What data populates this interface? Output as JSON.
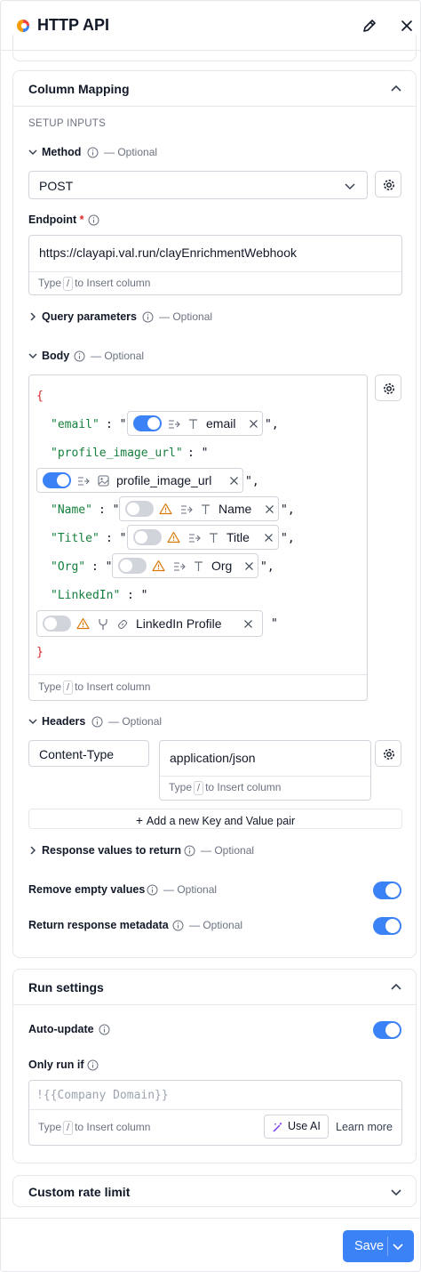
{
  "header": {
    "title": "HTTP API"
  },
  "column_mapping": {
    "title": "Column Mapping",
    "setup_inputs": "SETUP INPUTS",
    "method": {
      "label": "Method",
      "optional": "— Optional",
      "value": "POST"
    },
    "endpoint": {
      "label": "Endpoint",
      "required": "*",
      "value": "https://clayapi.val.run/clayEnrichmentWebhook",
      "hint_pre": "Type",
      "hint_key": "/",
      "hint_post": "to Insert column"
    },
    "query": {
      "label": "Query parameters",
      "optional": "— Optional"
    },
    "body": {
      "label": "Body",
      "optional": "— Optional",
      "open_brace": "{",
      "close_brace": "}",
      "keys": {
        "email": "\"email\"",
        "profile_image_url": "\"profile_image_url\"",
        "name": "\"Name\"",
        "title": "\"Title\"",
        "org": "\"Org\"",
        "linkedin": "\"LinkedIn\""
      },
      "colon_q": ": \"",
      "end_q": "\",",
      "end_q_last": "\"",
      "chips": {
        "email": "email",
        "profile_image_url": "profile_image_url",
        "name": "Name",
        "title": "Title",
        "org": "Org",
        "linkedin": "LinkedIn Profile"
      },
      "hint_pre": "Type",
      "hint_key": "/",
      "hint_post": "to Insert column"
    },
    "headers": {
      "label": "Headers",
      "optional": "— Optional",
      "key": "Content-Type",
      "value": "application/json",
      "hint_pre": "Type",
      "hint_key": "/",
      "hint_post": "to Insert column",
      "add_label": "Add a new Key and Value pair"
    },
    "response": {
      "label": "Response values to return",
      "optional": "— Optional"
    },
    "remove_empty": {
      "label": "Remove empty values",
      "optional": "— Optional",
      "on": true
    },
    "return_meta": {
      "label": "Return response metadata",
      "optional": "— Optional",
      "on": true
    }
  },
  "run_settings": {
    "title": "Run settings",
    "auto_update": {
      "label": "Auto-update",
      "on": true
    },
    "only_run_if": {
      "label": "Only run if",
      "placeholder": "!{{Company Domain}}",
      "hint_pre": "Type",
      "hint_key": "/",
      "hint_post": "to Insert column",
      "use_ai": "Use AI",
      "learn_more": "Learn more"
    }
  },
  "rate_limit": {
    "title": "Custom rate limit"
  },
  "footer": {
    "save": "Save"
  },
  "colors": {
    "accent": "#3b82f6",
    "green_code": "#15803d",
    "red_code": "#dc2626",
    "warning": "#d97706"
  }
}
